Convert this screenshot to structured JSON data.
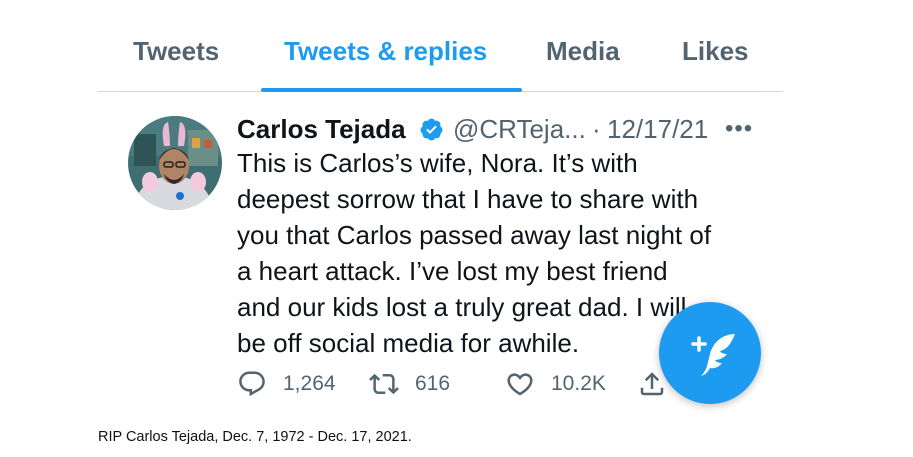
{
  "profile_tabs": [
    {
      "label": "Tweets",
      "active": false
    },
    {
      "label": "Tweets & replies",
      "active": true
    },
    {
      "label": "Media",
      "active": false
    },
    {
      "label": "Likes",
      "active": false
    }
  ],
  "tweet": {
    "author_name": "Carlos Tejada",
    "handle": "@CRTeja...",
    "separator": "·",
    "date": "12/17/21",
    "more_label": "•••",
    "text_lines": [
      "This is Carlos’s wife, Nora. It’s with",
      "deepest sorrow that I have to share with",
      "you that Carlos passed away last night of",
      "a heart attack. I’ve lost my best friend",
      "and our kids lost a truly great dad. I will",
      "be off social media for awhile."
    ],
    "replies": "1,264",
    "retweets": "616",
    "likes": "10.2K"
  },
  "icons": {
    "verified": "verified-badge-icon",
    "reply": "reply-icon",
    "retweet": "retweet-icon",
    "like": "heart-icon",
    "share": "share-icon",
    "compose": "compose-tweet-icon"
  },
  "colors": {
    "accent": "#1d9bf0",
    "secondary_text": "#536471",
    "primary_text": "#0f1419",
    "divider": "#cfd9de"
  },
  "caption": "RIP Carlos Tejada, Dec. 7, 1972 - Dec. 17, 2021."
}
